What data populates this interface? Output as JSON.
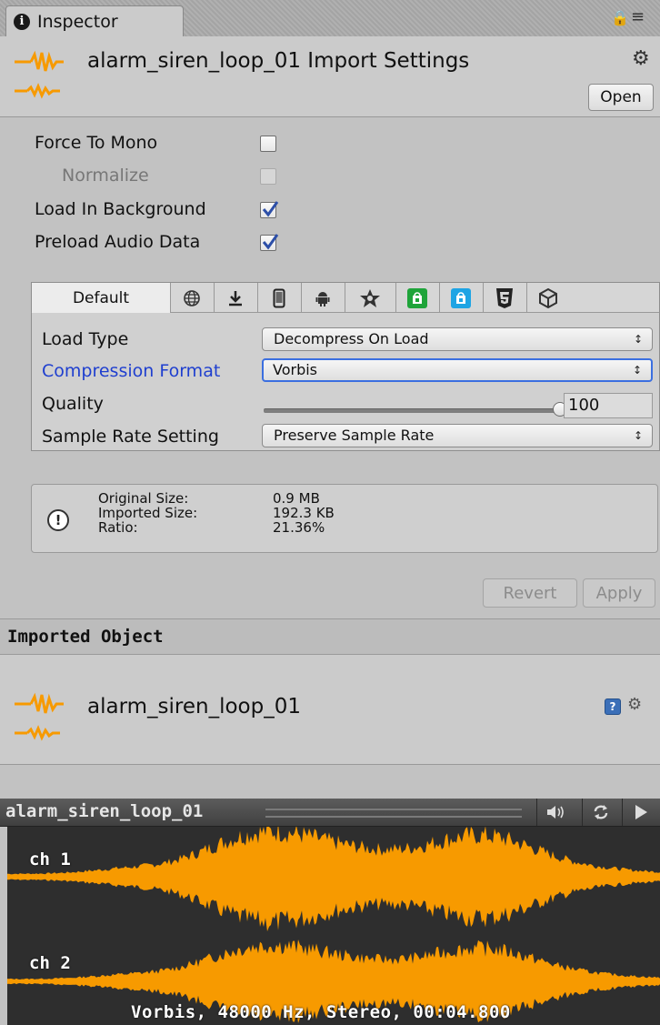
{
  "tab": {
    "title": "Inspector",
    "info_icon": "i"
  },
  "header": {
    "title": "alarm_siren_loop_01 Import Settings",
    "open_label": "Open"
  },
  "settings": {
    "force_to_mono": {
      "label": "Force To Mono",
      "checked": false
    },
    "normalize": {
      "label": "Normalize",
      "checked": false,
      "disabled": true
    },
    "load_in_background": {
      "label": "Load In Background",
      "checked": true
    },
    "preload_audio_data": {
      "label": "Preload Audio Data",
      "checked": true
    }
  },
  "platforms": {
    "default_label": "Default",
    "icons": [
      "globe-icon",
      "download-icon",
      "phone-icon",
      "android-icon",
      "tizen-icon",
      "xbox-store-icon",
      "windows-store-icon",
      "html5-icon",
      "unity-icon"
    ]
  },
  "platform_settings": {
    "load_type": {
      "label": "Load Type",
      "value": "Decompress On Load"
    },
    "compression_format": {
      "label": "Compression Format",
      "value": "Vorbis"
    },
    "quality": {
      "label": "Quality",
      "value": "100",
      "fraction": 1.0
    },
    "sample_rate_setting": {
      "label": "Sample Rate Setting",
      "value": "Preserve Sample Rate"
    }
  },
  "info": {
    "labels": [
      "Original Size:",
      "Imported Size:",
      "Ratio:"
    ],
    "values": [
      "0.9 MB",
      "192.3 KB",
      "21.36%"
    ]
  },
  "actions": {
    "revert": "Revert",
    "apply": "Apply"
  },
  "imported_object": {
    "header": "Imported Object",
    "name": "alarm_siren_loop_01"
  },
  "preview": {
    "title": "alarm_siren_loop_01",
    "channels": [
      "ch 1",
      "ch 2"
    ],
    "info": "Vorbis, 48000 Hz, Stereo, 00:04.800"
  },
  "colors": {
    "waveform": "#f79a00",
    "link_blue": "#1f3fcf",
    "focus_blue": "#3b6fe0"
  }
}
